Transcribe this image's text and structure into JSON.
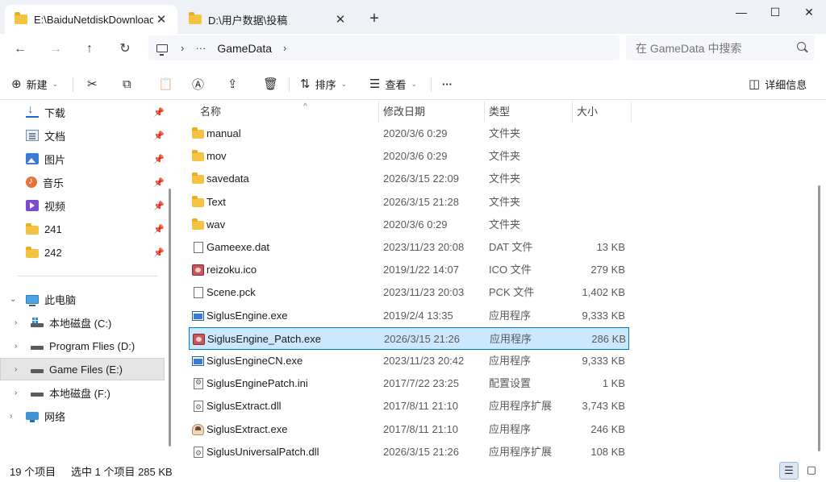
{
  "tabs": [
    {
      "title": "E:\\BaiduNetdiskDownloac",
      "active": true
    },
    {
      "title": "D:\\用户数据\\投稿",
      "active": false
    }
  ],
  "window_controls": {
    "minimize": "—",
    "maximize": "☐",
    "close": "✕"
  },
  "tab_close_glyph": "✕",
  "new_tab_glyph": "+",
  "nav": {
    "back": "←",
    "forward": "→",
    "up": "↑",
    "refresh": "↻"
  },
  "address": {
    "more": "···",
    "arrow": "›",
    "crumb": "GameData"
  },
  "search": {
    "placeholder": "在 GameData 中搜索"
  },
  "toolbar": {
    "new_label": "新建",
    "sort_label": "排序",
    "view_label": "查看",
    "more": "···",
    "details_label": "详细信息"
  },
  "sidebar": {
    "quick_access": [
      {
        "label": "下载",
        "icon": "download-icon"
      },
      {
        "label": "文档",
        "icon": "document-icon"
      },
      {
        "label": "图片",
        "icon": "pictures-icon"
      },
      {
        "label": "音乐",
        "icon": "music-icon"
      },
      {
        "label": "视频",
        "icon": "video-icon"
      },
      {
        "label": "241",
        "icon": "folder-icon"
      },
      {
        "label": "242",
        "icon": "folder-icon"
      }
    ],
    "this_pc": "此电脑",
    "drives": [
      {
        "label": "本地磁盘 (C:)",
        "selected": false
      },
      {
        "label": "Program Flies (D:)",
        "selected": false
      },
      {
        "label": "Game Files (E:)",
        "selected": true
      },
      {
        "label": "本地磁盘 (F:)",
        "selected": false
      }
    ],
    "network": "网络"
  },
  "columns": {
    "name": "名称",
    "date": "修改日期",
    "type": "类型",
    "size": "大小"
  },
  "files": [
    {
      "name": "manual",
      "date": "2020/3/6 0:29",
      "type": "文件夹",
      "size": "",
      "icon": "folder-icon"
    },
    {
      "name": "mov",
      "date": "2020/3/6 0:29",
      "type": "文件夹",
      "size": "",
      "icon": "folder-icon"
    },
    {
      "name": "savedata",
      "date": "2026/3/15 22:09",
      "type": "文件夹",
      "size": "",
      "icon": "folder-icon"
    },
    {
      "name": "Text",
      "date": "2026/3/15 21:28",
      "type": "文件夹",
      "size": "",
      "icon": "folder-icon"
    },
    {
      "name": "wav",
      "date": "2020/3/6 0:29",
      "type": "文件夹",
      "size": "",
      "icon": "folder-icon"
    },
    {
      "name": "Gameexe.dat",
      "date": "2023/11/23 20:08",
      "type": "DAT 文件",
      "size": "13 KB",
      "icon": "file-icon"
    },
    {
      "name": "reizoku.ico",
      "date": "2019/1/22 14:07",
      "type": "ICO 文件",
      "size": "279 KB",
      "icon": "image-ico-icon"
    },
    {
      "name": "Scene.pck",
      "date": "2023/11/23 20:03",
      "type": "PCK 文件",
      "size": "1,402 KB",
      "icon": "file-icon"
    },
    {
      "name": "SiglusEngine.exe",
      "date": "2019/2/4 13:35",
      "type": "应用程序",
      "size": "9,333 KB",
      "icon": "app-icon"
    },
    {
      "name": "SiglusEngine_Patch.exe",
      "date": "2026/3/15 21:26",
      "type": "应用程序",
      "size": "286 KB",
      "icon": "image-ico-icon",
      "selected": true
    },
    {
      "name": "SiglusEngineCN.exe",
      "date": "2023/11/23 20:42",
      "type": "应用程序",
      "size": "9,333 KB",
      "icon": "app-icon"
    },
    {
      "name": "SiglusEnginePatch.ini",
      "date": "2017/7/22 23:25",
      "type": "配置设置",
      "size": "1 KB",
      "icon": "settings-file-icon"
    },
    {
      "name": "SiglusExtract.dll",
      "date": "2017/8/11 21:10",
      "type": "应用程序扩展",
      "size": "3,743 KB",
      "icon": "dll-icon"
    },
    {
      "name": "SiglusExtract.exe",
      "date": "2017/8/11 21:10",
      "type": "应用程序",
      "size": "246 KB",
      "icon": "character-app-icon"
    },
    {
      "name": "SiglusUniversalPatch.dll",
      "date": "2026/3/15 21:26",
      "type": "应用程序扩展",
      "size": "108 KB",
      "icon": "dll-icon"
    }
  ],
  "status": {
    "count": "19 个项目",
    "selection": "选中 1 个项目 285 KB"
  }
}
